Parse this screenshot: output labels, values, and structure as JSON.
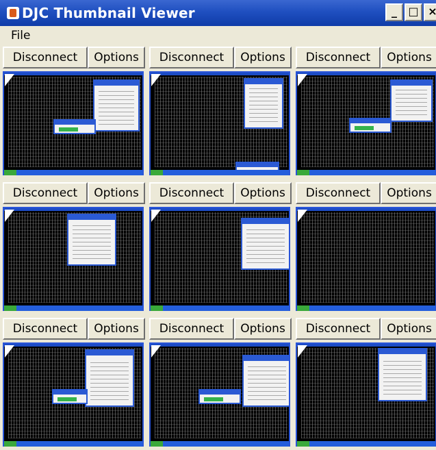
{
  "window": {
    "title": "DJC Thumbnail Viewer",
    "controls": {
      "minimize": "_",
      "maximize": "□",
      "close": "×"
    }
  },
  "menu": {
    "file": "File"
  },
  "buttons": {
    "disconnect": "Disconnect",
    "options": "Options"
  },
  "colors": {
    "titlebar": "#1f4fc0",
    "thumbBorder": "#2a55d8",
    "taskbar": "#245edc",
    "startButton": "#3aa93a"
  }
}
